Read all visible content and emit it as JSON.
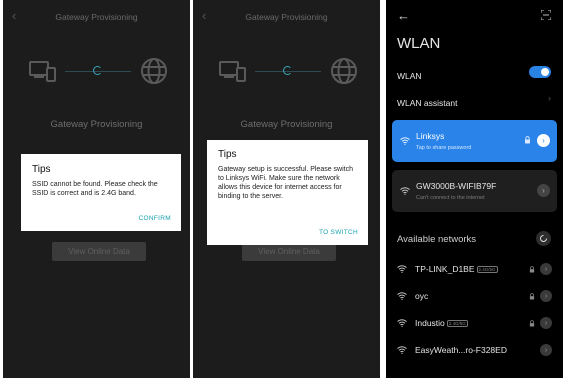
{
  "screen1": {
    "back_icon": "‹",
    "title": "Gateway Provisioning",
    "subtitle": "Gateway Provisioning",
    "online_button": "View Online Data",
    "dialog": {
      "title": "Tips",
      "message": "SSID cannot be found. Please check the SSID is correct and is 2.4G band.",
      "action": "CONFIRM"
    }
  },
  "screen2": {
    "back_icon": "‹",
    "title": "Gateway Provisioning",
    "subtitle": "Gateway Provisioning",
    "online_button": "View Online Data",
    "dialog": {
      "title": "Tips",
      "message": "Gateway setup is successful. Please switch to Linksys WiFi. Make sure the network allows this device for internet access for binding to the server.",
      "action": "TO SWITCH"
    }
  },
  "wlan": {
    "back_icon": "←",
    "title": "WLAN",
    "wlan_label": "WLAN",
    "wlan_enabled": true,
    "assistant_label": "WLAN assistant",
    "chevron": "›",
    "connected": [
      {
        "name": "Linksys",
        "status": "Tap to share password",
        "secured": true,
        "active": true
      },
      {
        "name": "GW3000B-WIFIB79F",
        "status": "Can't connect to the internet",
        "secured": false,
        "active": false
      }
    ],
    "available_title": "Available networks",
    "networks": [
      {
        "name": "TP-LINK_D1BE",
        "band": "2.4G/5G",
        "secured": true
      },
      {
        "name": "oyc",
        "band": "",
        "secured": true
      },
      {
        "name": "Industio",
        "band": "2.4G/5G",
        "secured": true
      },
      {
        "name": "EasyWeath...ro-F328ED",
        "band": "",
        "secured": false
      }
    ],
    "arrow_glyph": "›"
  },
  "colors": {
    "accent_teal": "#1aa1b0",
    "toggle_blue": "#2a82e4",
    "card_blue": "#2a83e8",
    "dark_bg": "#1c1c1c"
  }
}
